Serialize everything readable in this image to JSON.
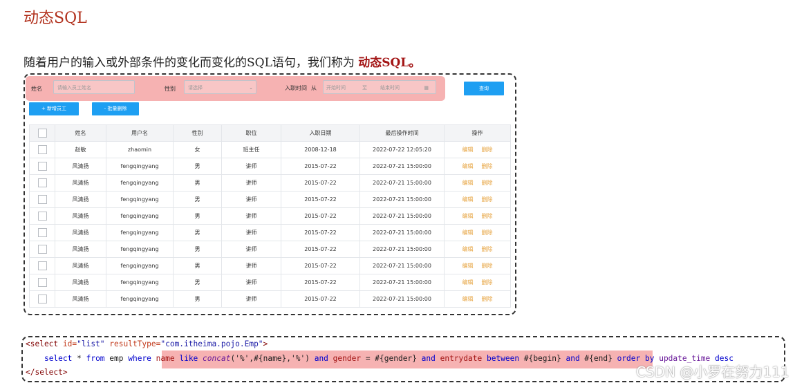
{
  "heading": "动态SQL",
  "description": {
    "text": "随着用户的输入或外部条件的变化而变化的SQL语句，我们称为 ",
    "highlight": "动态SQL。"
  },
  "filter": {
    "name_label": "姓名",
    "name_placeholder": "请输入员工姓名",
    "gender_label": "性别",
    "gender_placeholder": "请选择",
    "date_label": "入职时间",
    "date_from": "从",
    "date_start_placeholder": "开始时间",
    "date_to": "至",
    "date_end_placeholder": "结束时间",
    "query_button": "查询"
  },
  "actions": {
    "add_button": "+ 新增员工",
    "batch_delete_button": "- 批量删除"
  },
  "table": {
    "headers": [
      "姓名",
      "用户名",
      "性别",
      "职位",
      "入职日期",
      "最后操作时间",
      "操作"
    ],
    "edit_label": "编辑",
    "delete_label": "删除",
    "rows": [
      [
        "赵敏",
        "zhaomin",
        "女",
        "班主任",
        "2008-12-18",
        "2022-07-22 12:05:20"
      ],
      [
        "风清扬",
        "fengqingyang",
        "男",
        "讲师",
        "2015-07-22",
        "2022-07-21 15:00:00"
      ],
      [
        "风清扬",
        "fengqingyang",
        "男",
        "讲师",
        "2015-07-22",
        "2022-07-21 15:00:00"
      ],
      [
        "风清扬",
        "fengqingyang",
        "男",
        "讲师",
        "2015-07-22",
        "2022-07-21 15:00:00"
      ],
      [
        "风清扬",
        "fengqingyang",
        "男",
        "讲师",
        "2015-07-22",
        "2022-07-21 15:00:00"
      ],
      [
        "风清扬",
        "fengqingyang",
        "男",
        "讲师",
        "2015-07-22",
        "2022-07-21 15:00:00"
      ],
      [
        "风清扬",
        "fengqingyang",
        "男",
        "讲师",
        "2015-07-22",
        "2022-07-21 15:00:00"
      ],
      [
        "风清扬",
        "fengqingyang",
        "男",
        "讲师",
        "2015-07-22",
        "2022-07-21 15:00:00"
      ],
      [
        "风清扬",
        "fengqingyang",
        "男",
        "讲师",
        "2015-07-22",
        "2022-07-21 15:00:00"
      ],
      [
        "风清扬",
        "fengqingyang",
        "男",
        "讲师",
        "2015-07-22",
        "2022-07-21 15:00:00"
      ]
    ]
  },
  "code": {
    "line1": {
      "open": "<select",
      "id_attr": " id=",
      "id_val": "\"list\"",
      "rt_attr": " resultType=",
      "rt_val": "\"com.itheima.pojo.Emp\"",
      "close": ">"
    },
    "line2": {
      "indent": "    ",
      "select_kw": "select",
      "star": " * ",
      "from_kw": "from",
      "table": " emp ",
      "where_kw": "where",
      "name_col": " name ",
      "like_kw": "like",
      "concat_fn": " concat",
      "concat_args": "('%',#{name},'%') ",
      "and1": "and",
      "gender_col": " gender ",
      "gender_eq": "= #{gender} ",
      "and2": "and",
      "entry_col": " entrydate ",
      "between_kw": "between",
      "begin": " #{begin} ",
      "and3": "and",
      "end": " #{end} ",
      "order_kw": "order by",
      "update_col": " update_time ",
      "desc_kw": "desc"
    },
    "line3": "</select>"
  },
  "watermark": "CSDN @小罗在努力111"
}
